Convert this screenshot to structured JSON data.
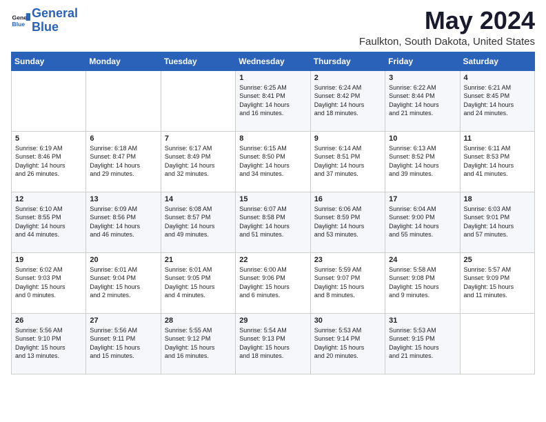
{
  "logo": {
    "text_general": "General",
    "text_blue": "Blue"
  },
  "header": {
    "month_year": "May 2024",
    "location": "Faulkton, South Dakota, United States"
  },
  "days_of_week": [
    "Sunday",
    "Monday",
    "Tuesday",
    "Wednesday",
    "Thursday",
    "Friday",
    "Saturday"
  ],
  "weeks": [
    [
      {
        "day": "",
        "content": ""
      },
      {
        "day": "",
        "content": ""
      },
      {
        "day": "",
        "content": ""
      },
      {
        "day": "1",
        "content": "Sunrise: 6:25 AM\nSunset: 8:41 PM\nDaylight: 14 hours\nand 16 minutes."
      },
      {
        "day": "2",
        "content": "Sunrise: 6:24 AM\nSunset: 8:42 PM\nDaylight: 14 hours\nand 18 minutes."
      },
      {
        "day": "3",
        "content": "Sunrise: 6:22 AM\nSunset: 8:44 PM\nDaylight: 14 hours\nand 21 minutes."
      },
      {
        "day": "4",
        "content": "Sunrise: 6:21 AM\nSunset: 8:45 PM\nDaylight: 14 hours\nand 24 minutes."
      }
    ],
    [
      {
        "day": "5",
        "content": "Sunrise: 6:19 AM\nSunset: 8:46 PM\nDaylight: 14 hours\nand 26 minutes."
      },
      {
        "day": "6",
        "content": "Sunrise: 6:18 AM\nSunset: 8:47 PM\nDaylight: 14 hours\nand 29 minutes."
      },
      {
        "day": "7",
        "content": "Sunrise: 6:17 AM\nSunset: 8:49 PM\nDaylight: 14 hours\nand 32 minutes."
      },
      {
        "day": "8",
        "content": "Sunrise: 6:15 AM\nSunset: 8:50 PM\nDaylight: 14 hours\nand 34 minutes."
      },
      {
        "day": "9",
        "content": "Sunrise: 6:14 AM\nSunset: 8:51 PM\nDaylight: 14 hours\nand 37 minutes."
      },
      {
        "day": "10",
        "content": "Sunrise: 6:13 AM\nSunset: 8:52 PM\nDaylight: 14 hours\nand 39 minutes."
      },
      {
        "day": "11",
        "content": "Sunrise: 6:11 AM\nSunset: 8:53 PM\nDaylight: 14 hours\nand 41 minutes."
      }
    ],
    [
      {
        "day": "12",
        "content": "Sunrise: 6:10 AM\nSunset: 8:55 PM\nDaylight: 14 hours\nand 44 minutes."
      },
      {
        "day": "13",
        "content": "Sunrise: 6:09 AM\nSunset: 8:56 PM\nDaylight: 14 hours\nand 46 minutes."
      },
      {
        "day": "14",
        "content": "Sunrise: 6:08 AM\nSunset: 8:57 PM\nDaylight: 14 hours\nand 49 minutes."
      },
      {
        "day": "15",
        "content": "Sunrise: 6:07 AM\nSunset: 8:58 PM\nDaylight: 14 hours\nand 51 minutes."
      },
      {
        "day": "16",
        "content": "Sunrise: 6:06 AM\nSunset: 8:59 PM\nDaylight: 14 hours\nand 53 minutes."
      },
      {
        "day": "17",
        "content": "Sunrise: 6:04 AM\nSunset: 9:00 PM\nDaylight: 14 hours\nand 55 minutes."
      },
      {
        "day": "18",
        "content": "Sunrise: 6:03 AM\nSunset: 9:01 PM\nDaylight: 14 hours\nand 57 minutes."
      }
    ],
    [
      {
        "day": "19",
        "content": "Sunrise: 6:02 AM\nSunset: 9:03 PM\nDaylight: 15 hours\nand 0 minutes."
      },
      {
        "day": "20",
        "content": "Sunrise: 6:01 AM\nSunset: 9:04 PM\nDaylight: 15 hours\nand 2 minutes."
      },
      {
        "day": "21",
        "content": "Sunrise: 6:01 AM\nSunset: 9:05 PM\nDaylight: 15 hours\nand 4 minutes."
      },
      {
        "day": "22",
        "content": "Sunrise: 6:00 AM\nSunset: 9:06 PM\nDaylight: 15 hours\nand 6 minutes."
      },
      {
        "day": "23",
        "content": "Sunrise: 5:59 AM\nSunset: 9:07 PM\nDaylight: 15 hours\nand 8 minutes."
      },
      {
        "day": "24",
        "content": "Sunrise: 5:58 AM\nSunset: 9:08 PM\nDaylight: 15 hours\nand 9 minutes."
      },
      {
        "day": "25",
        "content": "Sunrise: 5:57 AM\nSunset: 9:09 PM\nDaylight: 15 hours\nand 11 minutes."
      }
    ],
    [
      {
        "day": "26",
        "content": "Sunrise: 5:56 AM\nSunset: 9:10 PM\nDaylight: 15 hours\nand 13 minutes."
      },
      {
        "day": "27",
        "content": "Sunrise: 5:56 AM\nSunset: 9:11 PM\nDaylight: 15 hours\nand 15 minutes."
      },
      {
        "day": "28",
        "content": "Sunrise: 5:55 AM\nSunset: 9:12 PM\nDaylight: 15 hours\nand 16 minutes."
      },
      {
        "day": "29",
        "content": "Sunrise: 5:54 AM\nSunset: 9:13 PM\nDaylight: 15 hours\nand 18 minutes."
      },
      {
        "day": "30",
        "content": "Sunrise: 5:53 AM\nSunset: 9:14 PM\nDaylight: 15 hours\nand 20 minutes."
      },
      {
        "day": "31",
        "content": "Sunrise: 5:53 AM\nSunset: 9:15 PM\nDaylight: 15 hours\nand 21 minutes."
      },
      {
        "day": "",
        "content": ""
      }
    ]
  ]
}
